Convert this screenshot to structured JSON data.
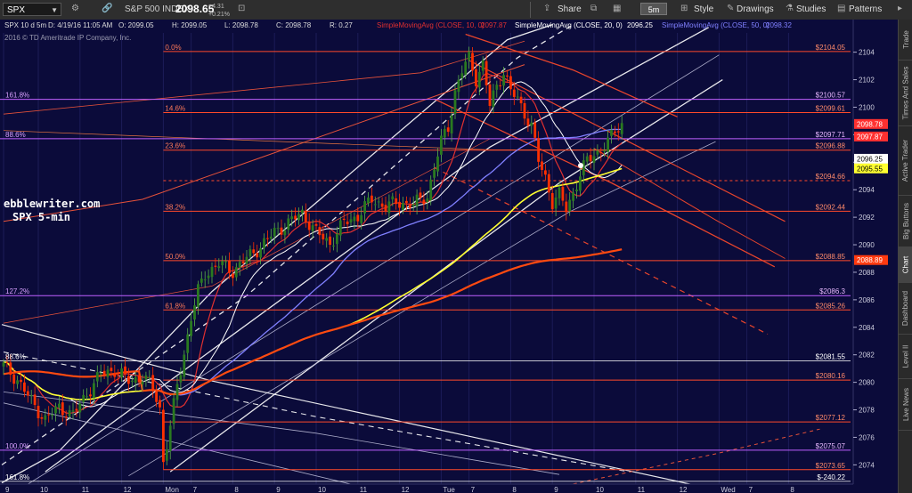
{
  "toolbar": {
    "symbol": "SPX",
    "index_name": "S&P 500 INDEX",
    "last_price": "2098.65",
    "change": "+4.31",
    "change_pct": "+0.21%",
    "share_label": "Share",
    "aggregation": "5m",
    "style_label": "Style",
    "drawings_label": "Drawings",
    "studies_label": "Studies",
    "patterns_label": "Patterns"
  },
  "header": {
    "info": "SPX 10 d 5m",
    "datetime": "D: 4/19/16 11:05 AM",
    "open": "O: 2099.05",
    "high": "H: 2099.05",
    "low": "L: 2098.78",
    "close": "C: 2098.78",
    "range": "R: 0.27",
    "copyright": "2016 © TD Ameritrade IP Company, Inc.",
    "studies": [
      {
        "label": "SimpleMovingAvg (CLOSE, 10, 0)",
        "value": "2097.87",
        "color": "#e03030"
      },
      {
        "label": "SimpleMovingAvg (CLOSE, 20, 0)",
        "value": "2096.25",
        "color": "#ffffff"
      },
      {
        "label": "SimpleMovingAvg (CLOSE, 50, 0)",
        "value": "2098.32",
        "color": "#8080ff"
      }
    ]
  },
  "watermark": {
    "line1": "ebblewriter.com",
    "line2": "SPX 5-min"
  },
  "right_nav": [
    "Trade",
    "Times And Sales",
    "Active Trader",
    "Big Buttons",
    "Chart",
    "Dashboard",
    "Level II",
    "Live News"
  ],
  "active_tab": "Chart",
  "colors": {
    "background": "#0b0b3a",
    "up_candle": "#2a7a20",
    "down_candle": "#ff3000",
    "fib_red": "#ff4a2a",
    "fib_purple": "#c060ff",
    "sma10": "#e03030",
    "sma20": "#ffffff",
    "sma50": "#8080ff",
    "sma100": "#ffff30",
    "sma200": "#ff4a10"
  },
  "chart_data": {
    "type": "candlestick",
    "ylim": [
      2072.6,
      2105.4
    ],
    "y_ticks": [
      2074,
      2076,
      2078,
      2080,
      2082,
      2084,
      2086,
      2088,
      2090,
      2092,
      2094,
      2096,
      2098,
      2100,
      2102,
      2104
    ],
    "x_labels": [
      {
        "i": 0,
        "t": "9"
      },
      {
        "i": 10,
        "t": "10"
      },
      {
        "i": 22,
        "t": "11"
      },
      {
        "i": 34,
        "t": "12"
      },
      {
        "i": 46,
        "t": "Mon"
      },
      {
        "i": 54,
        "t": "7"
      },
      {
        "i": 66,
        "t": "8"
      },
      {
        "i": 78,
        "t": "9"
      },
      {
        "i": 90,
        "t": "10"
      },
      {
        "i": 102,
        "t": "11"
      },
      {
        "i": 114,
        "t": "12"
      },
      {
        "i": 126,
        "t": "Tue"
      },
      {
        "i": 134,
        "t": "7"
      },
      {
        "i": 146,
        "t": "8"
      },
      {
        "i": 158,
        "t": "9"
      },
      {
        "i": 170,
        "t": "10"
      },
      {
        "i": 182,
        "t": "11"
      },
      {
        "i": 194,
        "t": "12"
      },
      {
        "i": 206,
        "t": "Wed"
      },
      {
        "i": 214,
        "t": "7"
      },
      {
        "i": 226,
        "t": "8"
      }
    ],
    "fib_levels": [
      {
        "pct": "0.0%",
        "price": 2104.05,
        "label": "$2104.05",
        "color": "#ff4a2a"
      },
      {
        "pct": "14.6%",
        "price": 2099.61,
        "label": "$2099.61",
        "color": "#ff4a2a"
      },
      {
        "pct": "23.6%",
        "price": 2096.88,
        "label": "$2096.88",
        "color": "#ff4a2a"
      },
      {
        "pct": "",
        "price": 2094.66,
        "label": "$2094.66",
        "color": "#ff4a2a",
        "dashed": true
      },
      {
        "pct": "38.2%",
        "price": 2092.44,
        "label": "$2092.44",
        "color": "#ff4a2a"
      },
      {
        "pct": "50.0%",
        "price": 2088.85,
        "label": "$2088.85",
        "color": "#ff4a2a"
      },
      {
        "pct": "61.8%",
        "price": 2085.26,
        "label": "$2085.26",
        "color": "#ff4a2a"
      },
      {
        "pct": "",
        "price": 2080.16,
        "label": "$2080.16",
        "color": "#ff4a2a"
      },
      {
        "pct": "",
        "price": 2077.12,
        "label": "$2077.12",
        "color": "#ff4a2a"
      },
      {
        "pct": "",
        "price": 2073.65,
        "label": "$2073.65",
        "color": "#ff4a2a"
      },
      {
        "pct": "161.8%",
        "price": 2100.57,
        "label": "$2100.57",
        "color": "#c060ff"
      },
      {
        "pct": "88.6%",
        "price": 2097.71,
        "label": "$2097.71",
        "color": "#c060ff"
      },
      {
        "pct": "127.2%",
        "price": 2086.3,
        "label": "$2086.3",
        "color": "#c060ff"
      },
      {
        "pct": "100.0%",
        "price": 2075.07,
        "label": "$2075.07",
        "color": "#c060ff"
      },
      {
        "pct": "88.6%",
        "price": 2081.55,
        "label": "$2081.55",
        "color": "#ffffff"
      },
      {
        "pct": "161.8%",
        "price": 2072.8,
        "label": "$-240.22",
        "color": "#ffffff"
      }
    ],
    "price_badges": [
      {
        "label": "2098.78",
        "price": 2098.78,
        "bg": "#ff3030",
        "fg": "#ffffff"
      },
      {
        "label": "2097.87",
        "price": 2097.87,
        "bg": "#ff3030",
        "fg": "#ffffff"
      },
      {
        "label": "2096.25",
        "price": 2096.25,
        "bg": "#ffffff",
        "fg": "#000000"
      },
      {
        "label": "2095.55",
        "price": 2095.55,
        "bg": "#ffff30",
        "fg": "#000000"
      },
      {
        "label": "2088.89",
        "price": 2088.89,
        "bg": "#ff3a10",
        "fg": "#ffffff"
      }
    ],
    "candle_anchors": [
      [
        0,
        2081.2
      ],
      [
        4,
        2080.2
      ],
      [
        8,
        2078.6
      ],
      [
        12,
        2077.3
      ],
      [
        16,
        2078.2
      ],
      [
        20,
        2077.6
      ],
      [
        24,
        2079.2
      ],
      [
        28,
        2080.6
      ],
      [
        32,
        2080.9
      ],
      [
        36,
        2080.1
      ],
      [
        40,
        2080.4
      ],
      [
        43,
        2079.6
      ],
      [
        45,
        2078.1
      ],
      [
        46,
        2074.3
      ],
      [
        48,
        2076.7
      ],
      [
        50,
        2079.8
      ],
      [
        52,
        2082.1
      ],
      [
        54,
        2084.7
      ],
      [
        56,
        2086.6
      ],
      [
        58,
        2087.9
      ],
      [
        62,
        2088.6
      ],
      [
        66,
        2088.1
      ],
      [
        70,
        2089.0
      ],
      [
        74,
        2089.9
      ],
      [
        78,
        2090.9
      ],
      [
        82,
        2091.6
      ],
      [
        86,
        2092.3
      ],
      [
        90,
        2090.9
      ],
      [
        94,
        2090.1
      ],
      [
        98,
        2091.6
      ],
      [
        102,
        2092.1
      ],
      [
        106,
        2093.3
      ],
      [
        110,
        2092.8
      ],
      [
        114,
        2093.1
      ],
      [
        118,
        2092.9
      ],
      [
        122,
        2093.6
      ],
      [
        126,
        2097.5
      ],
      [
        128,
        2098.6
      ],
      [
        130,
        2101.1
      ],
      [
        132,
        2102.6
      ],
      [
        134,
        2103.6
      ],
      [
        136,
        2102.1
      ],
      [
        138,
        2103.1
      ],
      [
        140,
        2100.1
      ],
      [
        142,
        2101.6
      ],
      [
        144,
        2102.6
      ],
      [
        146,
        2101.1
      ],
      [
        148,
        2100.6
      ],
      [
        150,
        2099.6
      ],
      [
        152,
        2098.6
      ],
      [
        154,
        2096.1
      ],
      [
        156,
        2094.9
      ],
      [
        158,
        2093.1
      ],
      [
        160,
        2093.6
      ],
      [
        162,
        2092.6
      ],
      [
        164,
        2093.8
      ],
      [
        166,
        2095.1
      ],
      [
        168,
        2096.1
      ],
      [
        170,
        2096.6
      ],
      [
        172,
        2096.9
      ],
      [
        174,
        2097.4
      ],
      [
        176,
        2098.3
      ],
      [
        178,
        2098.8
      ]
    ]
  }
}
